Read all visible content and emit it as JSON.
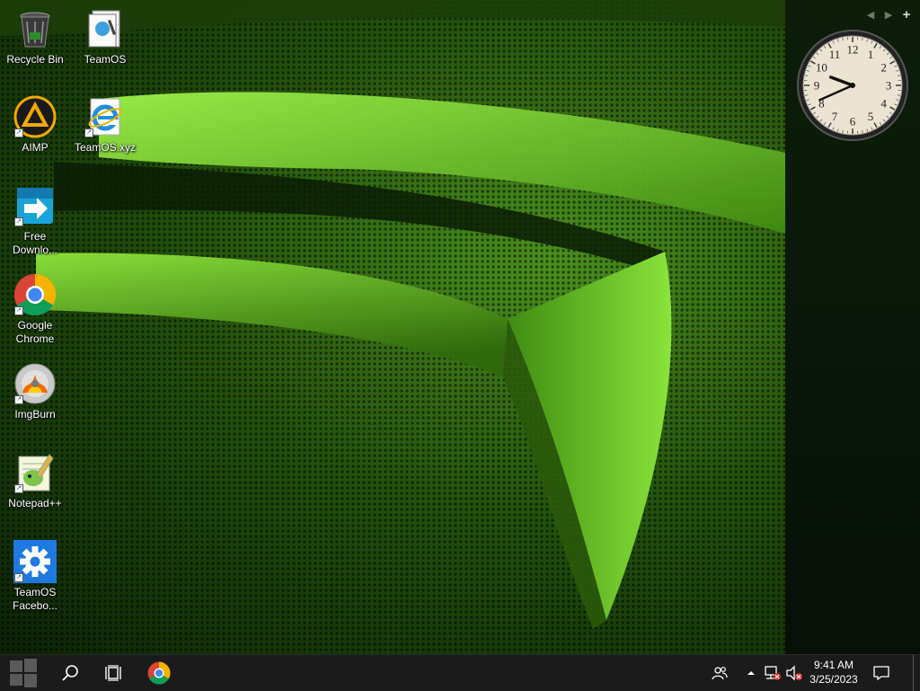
{
  "desktop_icons": [
    {
      "label": "Recycle Bin",
      "icon": "recycle-bin-icon"
    },
    {
      "label": "TeamOS",
      "icon": "document-folder-icon"
    },
    {
      "label": "AIMP",
      "icon": "aimp-icon"
    },
    {
      "label": "TeamOS.xyz",
      "icon": "internet-explorer-icon"
    },
    {
      "label": "Free Downlo...",
      "icon": "free-download-manager-icon"
    },
    {
      "label": "Google Chrome",
      "icon": "chrome-icon"
    },
    {
      "label": "ImgBurn",
      "icon": "imgburn-icon"
    },
    {
      "label": "Notepad++",
      "icon": "notepad-plus-plus-icon"
    },
    {
      "label": "TeamOS Facebo...",
      "icon": "gear-icon"
    }
  ],
  "clock": {
    "numerals": [
      "12",
      "1",
      "2",
      "3",
      "4",
      "5",
      "6",
      "7",
      "8",
      "9",
      "10",
      "11"
    ]
  },
  "taskbar": {
    "time": "9:41 AM",
    "date": "3/25/2023",
    "pinned": [
      "start-icon",
      "search-icon",
      "task-view-icon",
      "chrome-icon"
    ],
    "tray": [
      "people-icon",
      "chevron-up-icon",
      "network-icon",
      "volume-muted-icon",
      "notification-icon"
    ]
  },
  "colors": {
    "taskbar": "#1b1b1b",
    "wallpaper_accent": "#7ddf2a"
  }
}
